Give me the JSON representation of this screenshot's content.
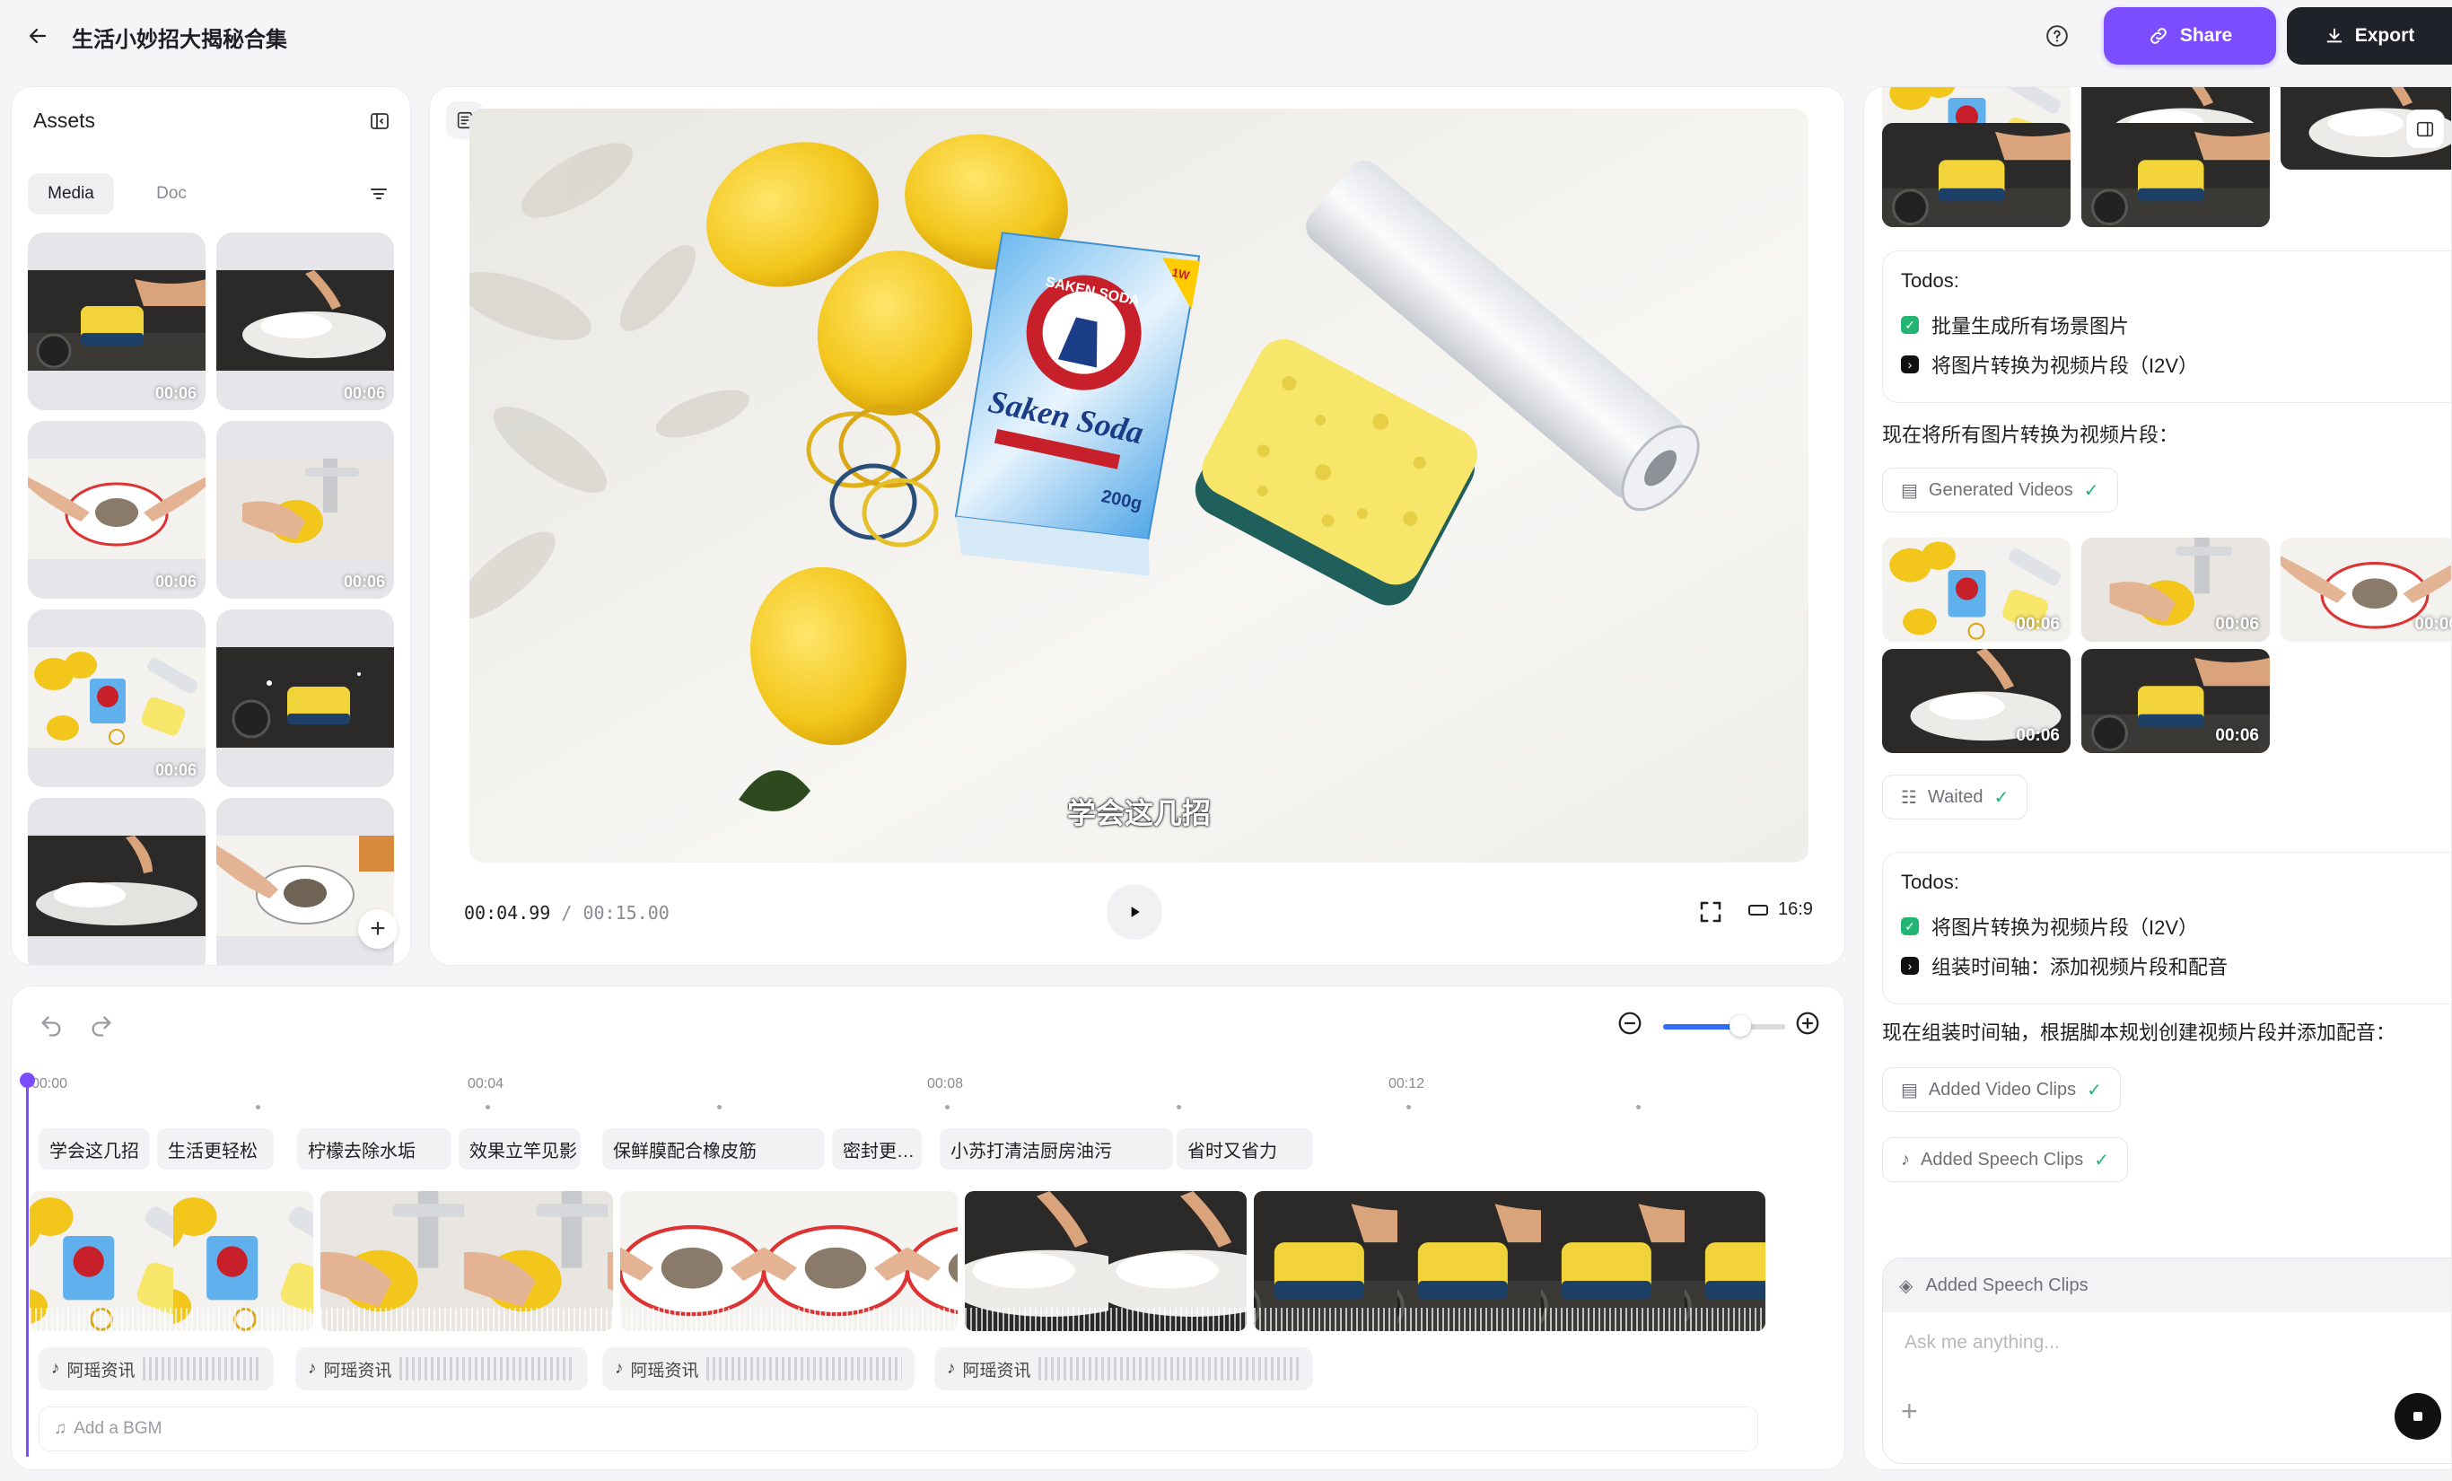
{
  "header": {
    "title": "生活小妙招大揭秘合集",
    "share_label": "Share",
    "export_label": "Export"
  },
  "assets": {
    "title": "Assets",
    "tabs": [
      "Media",
      "Doc"
    ],
    "items": [
      {
        "scene": "stove-sponge",
        "duration": "00:06"
      },
      {
        "scene": "soda-stove",
        "duration": "00:06"
      },
      {
        "scene": "plate-wrap",
        "duration": "00:06"
      },
      {
        "scene": "faucet-lemon",
        "duration": "00:06"
      },
      {
        "scene": "lemons-soda",
        "duration": "00:06"
      },
      {
        "scene": "stove-sponge2",
        "duration": ""
      },
      {
        "scene": "soda-stove2",
        "duration": ""
      },
      {
        "scene": "plate-wrap2",
        "duration": ""
      }
    ]
  },
  "preview": {
    "subtitle": "学会这几招",
    "current_time": "00:04.99",
    "separator": " / ",
    "total_time": "00:15.00",
    "aspect_ratio": "16:9",
    "box_brand": "SAKEN SODA",
    "box_name": "Saken Soda",
    "box_weight": "200g",
    "box_badge": "1W"
  },
  "timeline": {
    "ticks": [
      "00:00",
      "00:04",
      "00:08",
      "00:12"
    ],
    "zoom_level": 0.63,
    "captions": [
      "学会这几招",
      "生活更轻松",
      "柠檬去除水垢",
      "效果立竿见影",
      "保鲜膜配合橡皮筋",
      "密封更…",
      "小苏打清洁厨房油污",
      "省时又省力"
    ],
    "audio_label": "阿瑶资讯",
    "bgm_label": "Add a BGM"
  },
  "chat": {
    "top_thumbs": [
      "lemons-soda",
      "soda-stove",
      "soda-stove",
      "stove-sponge",
      "stove-sponge"
    ],
    "todos1": {
      "title": "Todos:",
      "items": [
        {
          "text": "批量生成所有场景图片",
          "done": true
        },
        {
          "text": "将图片转换为视频片段（I2V）",
          "done": false
        }
      ]
    },
    "msg1": "现在将所有图片转换为视频片段：",
    "pill_generated": "Generated Videos",
    "videos": [
      {
        "scene": "lemons-soda",
        "duration": "00:06"
      },
      {
        "scene": "faucet-lemon",
        "duration": "00:06"
      },
      {
        "scene": "plate-wrap",
        "duration": "00:06"
      },
      {
        "scene": "soda-stove",
        "duration": "00:06"
      },
      {
        "scene": "stove-sponge",
        "duration": "00:06"
      }
    ],
    "pill_waited": "Waited",
    "todos2": {
      "title": "Todos:",
      "items": [
        {
          "text": "将图片转换为视频片段（I2V）",
          "done": true
        },
        {
          "text": "组装时间轴：添加视频片段和配音",
          "done": false
        }
      ]
    },
    "msg2": "现在组装时间轴，根据脚本规划创建视频片段并添加配音：",
    "pill_video_clips": "Added Video Clips",
    "pill_speech_clips": "Added Speech Clips",
    "input_status": "Added Speech Clips",
    "input_placeholder": "Ask me anything..."
  },
  "colors": {
    "accent": "#7c4dff",
    "export": "#1f2329",
    "done": "#22b573",
    "playhead": "#7c4dff",
    "zoom": "#2f6bff"
  }
}
